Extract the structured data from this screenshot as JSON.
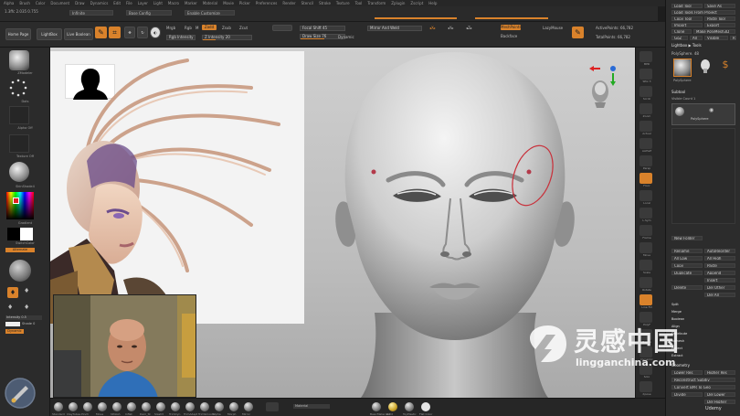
{
  "menubar": {
    "items": [
      "Alpha",
      "Brush",
      "Color",
      "Document",
      "Draw",
      "Dynamics",
      "Edit",
      "File",
      "Layer",
      "Light",
      "Macro",
      "Marker",
      "Material",
      "Movie",
      "Picker",
      "Preferences",
      "Render",
      "Stencil",
      "Stroke",
      "Texture",
      "Tool",
      "Transform",
      "Zplugin",
      "Zscript",
      "Help"
    ]
  },
  "status": {
    "coords": "1.3ffc 2.035 0.755",
    "field_a": "Infinite",
    "field_b": "Base Config",
    "field_c": "Enable Customize"
  },
  "toolbar": {
    "home": "Home Page",
    "lightbox": "LightBox",
    "live_boolean": "Live Boolean",
    "edit": "Edit",
    "draw": "Draw",
    "move": "Move",
    "scale": "Scale",
    "rotate": "Rotate",
    "mrgb": "Mrgb",
    "rgb": "Rgb",
    "m": "M",
    "zadd": "Zadd",
    "zsub": "Zsub",
    "zcut": "Zcut",
    "z_intensity": "Z Intensity 20",
    "rgb_intensity": "Rgb Intensity",
    "focal_shift": "Focal Shift 45",
    "draw_size": "Draw Size 76",
    "dynamic": "Dynamic",
    "mirror_weld": "Mirror And Weld",
    "active_points": "ActivePoints: 66,782",
    "total_points": "TotalPoints: 66,782",
    "mesh_points": "MeshPoints",
    "lazy_mouse": "LazyMouse",
    "backface": "Backface"
  },
  "left_shelf": {
    "brush_label": "ZModeler",
    "stroke_label": "Dots",
    "alpha_label": "Alpha Off",
    "texture_label": "Texture Off",
    "material_label": "SkinShade4",
    "gradient_label": "Gradient",
    "switch_color": "SwitchColor",
    "alternate": "Alternate",
    "intensity": "Intensity 0.5",
    "shade": "Shade 0",
    "dynamic": "Dynamic"
  },
  "right_column": {
    "items": [
      "BPR",
      "SPix 3",
      "Scroll",
      "Zoom",
      "Actual",
      "AAHalf",
      "Persp",
      "Floor",
      "Local",
      "L.Sym",
      "Frame",
      "Move",
      "Scale",
      "Rotate",
      "Line Fill",
      "PolyF",
      "Transp",
      "Dynamic",
      "Solo",
      "Xpose"
    ]
  },
  "palette": {
    "tool_title": "Tool",
    "load_tool": "Load Tool",
    "save_as": "Save As",
    "load_project": "Load Tools From Project",
    "copy_tool": "Copy Tool",
    "paste_tool": "Paste Tool",
    "import": "Import",
    "export": "Export",
    "clone": "Clone",
    "make_polymesh": "Make PolyMesh3D",
    "goz": "GoZ",
    "all": "All",
    "visible": "Visible",
    "r": "R",
    "lightbox_tools": "Lightbox ▶ Tools",
    "polysphere_count": "PolySphere. 48",
    "polysphere": "PolySphere",
    "subtool": "Subtool",
    "visible_count": "Visible Count 1",
    "polysphere_sub": "PolySphere",
    "new_folder": "New Folder",
    "rename": "Rename",
    "autoreorder": "AutoReorder",
    "all_low": "All Low",
    "all_high": "All High",
    "copy": "Copy",
    "paste": "Paste",
    "duplicate": "Duplicate",
    "append": "Append",
    "insert": "Insert",
    "delete": "Delete",
    "del_other": "Del Other",
    "del_all": "Del All",
    "split": "Split",
    "merge": "Merge",
    "boolean": "Boolean",
    "align": "Align",
    "distribute": "Distribute",
    "remesh": "Remesh",
    "project": "Project",
    "extract": "Extract",
    "geometry": "Geometry",
    "higher_res": "Higher Res",
    "lower_res": "Lower Res",
    "reconstruct_subdiv": "Reconstruct Subdiv",
    "convert_bpr": "Convert BPR To Geo",
    "divide": "Divide",
    "del_lower": "Del Lower",
    "del_higher": "Del Higher"
  },
  "bottom_shelf": {
    "brushes": [
      "Standard",
      "ClayTubes",
      "Pinch",
      "Move",
      "hPolish",
      "Inflat",
      "Dam_St",
      "Slash3",
      "TrimDyn",
      "TrimAdapt",
      "TrimSmooth",
      "Alpha",
      "Morph",
      "Mirror"
    ],
    "materials": [
      "BasicMaterial2",
      "Gold",
      "ToyPlastic",
      "Flat Color"
    ],
    "material_label": "Material"
  },
  "watermark": {
    "cn": "灵感中国",
    "url": "lingganchina.com"
  },
  "udemy": "Udemy",
  "colors": {
    "accent": "#d9822b",
    "ui_bg": "#2b2b2b",
    "canvas_bg": "#c4c4c4"
  }
}
